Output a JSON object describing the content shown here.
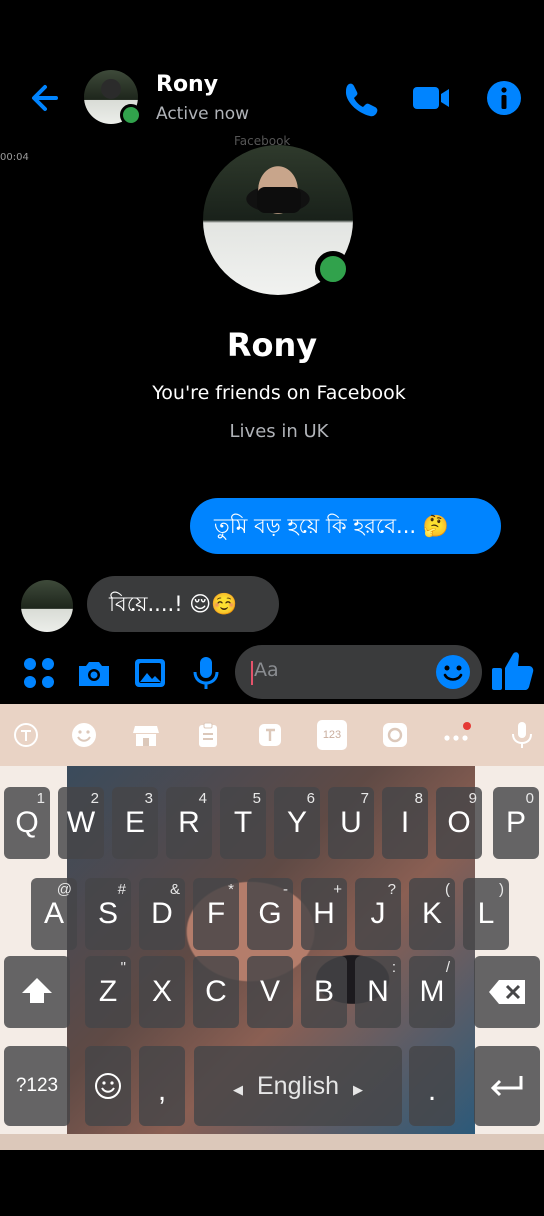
{
  "header": {
    "name": "Rony",
    "status": "Active now"
  },
  "timestamp": "00:04",
  "page_hint": "Facebook",
  "profile": {
    "name": "Rony",
    "friends": "You're friends on Facebook",
    "lives": "Lives in UK"
  },
  "messages": [
    {
      "direction": "outgoing",
      "text": "তুমি বড় হয়ে কি হরবে... 🤔"
    },
    {
      "direction": "incoming",
      "text": "বিয়ে....! 😌☺️"
    }
  ],
  "composer": {
    "placeholder": "Aa"
  },
  "keyboard": {
    "row1": [
      [
        "Q",
        "1"
      ],
      [
        "W",
        "2"
      ],
      [
        "E",
        "3"
      ],
      [
        "R",
        "4"
      ],
      [
        "T",
        "5"
      ],
      [
        "Y",
        "6"
      ],
      [
        "U",
        "7"
      ],
      [
        "I",
        "8"
      ],
      [
        "O",
        "9"
      ],
      [
        "P",
        "0"
      ]
    ],
    "row2": [
      [
        "A",
        "@"
      ],
      [
        "S",
        "#"
      ],
      [
        "D",
        "&"
      ],
      [
        "F",
        "*"
      ],
      [
        "G",
        "-"
      ],
      [
        "H",
        "+"
      ],
      [
        "J",
        "?"
      ],
      [
        "K",
        "("
      ],
      [
        "L",
        ")"
      ]
    ],
    "row3": [
      [
        "Z",
        "\""
      ],
      [
        "X",
        ""
      ],
      [
        "C",
        ""
      ],
      [
        "V",
        ""
      ],
      [
        "B",
        ""
      ],
      [
        "N",
        ":"
      ],
      [
        "M",
        "/"
      ]
    ],
    "sym_key": "?123",
    "comma": ",",
    "space_label": "English",
    "period": ".",
    "toolbar_badge": "123"
  },
  "colors": {
    "accent": "#0084ff",
    "online": "#31a24c",
    "bubble_in": "#3a3b3c"
  }
}
